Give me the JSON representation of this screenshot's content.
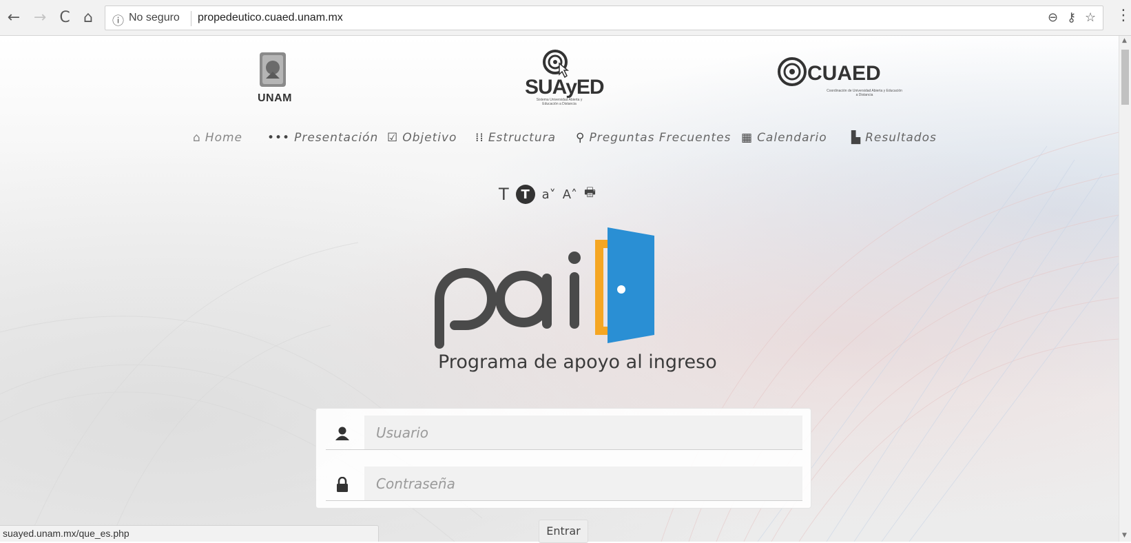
{
  "browser": {
    "back_icon": "arrow-left-icon",
    "forward_icon": "arrow-right-icon",
    "reload_icon": "reload-icon",
    "home_icon": "home-icon",
    "security_label": "No seguro",
    "url": "propedeutico.cuaed.unam.mx",
    "zoom_icon": "zoom-out-icon",
    "key_icon": "key-icon",
    "bookmark_icon": "star-icon",
    "menu_icon": "vertical-dots-icon"
  },
  "header": {
    "unam_label": "UNAM",
    "suayed_label": "SUAyED",
    "suayed_subtitle": "Sistema Universidad Abierta y Educación a Distancia",
    "cuaed_label": "CUAED",
    "cuaed_subtitle": "Coordinación de Universidad Abierta y Educación a Distancia"
  },
  "menu": {
    "items": [
      {
        "label": "Home",
        "icon": "home-icon"
      },
      {
        "label": "Presentación",
        "icon": "ellipsis-icon"
      },
      {
        "label": "Objetivo",
        "icon": "checkbox-icon"
      },
      {
        "label": "Estructura",
        "icon": "sitemap-icon"
      },
      {
        "label": "Preguntas Frecuentes",
        "icon": "search-icon"
      },
      {
        "label": "Calendario",
        "icon": "calendar-icon"
      },
      {
        "label": "Resultados",
        "icon": "file-icon"
      }
    ]
  },
  "accessibility": {
    "text_normal": "T",
    "text_contrast": "T",
    "font_decrease": "a˅",
    "font_increase": "A˄",
    "print_icon": "print-icon"
  },
  "brand": {
    "logo_text": "pai",
    "tagline": "Programa de apoyo al ingreso",
    "colors": {
      "orange": "#f5a623",
      "blue": "#2a8fd4",
      "gray": "#4a4a4a"
    }
  },
  "login": {
    "username_placeholder": "Usuario",
    "password_placeholder": "Contraseña",
    "submit_label": "Entrar"
  },
  "status_bar": {
    "text": "suayed.unam.mx/que_es.php"
  }
}
